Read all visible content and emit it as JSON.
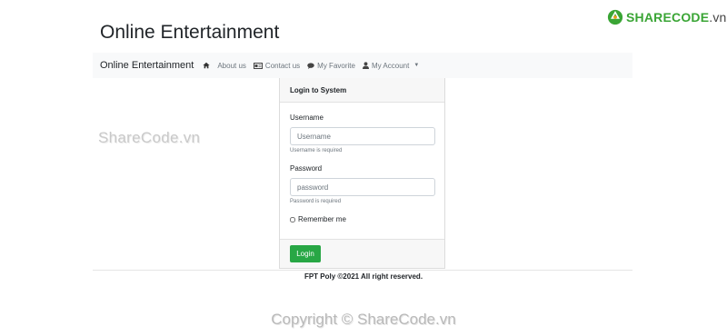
{
  "watermark_logo": {
    "green": "SHARECODE",
    "rest": ".vn"
  },
  "site_title": "Online Entertainment",
  "nav": {
    "brand": "Online Entertainment",
    "home_icon": "home-icon",
    "items": [
      {
        "label": "About us",
        "icon": ""
      },
      {
        "label": "Contact us",
        "icon": "card-icon"
      },
      {
        "label": "My Favorite",
        "icon": "comment-icon"
      },
      {
        "label": "My Account",
        "icon": "user-icon"
      }
    ]
  },
  "login": {
    "title": "Login to System",
    "username_label": "Username",
    "username_placeholder": "Username",
    "username_hint": "Username is required",
    "password_label": "Password",
    "password_placeholder": "password",
    "password_hint": "Password is required",
    "remember_label": "Remember me",
    "submit_label": "Login"
  },
  "footer": "FPT Poly ©2021 All right reserved.",
  "watermarks": {
    "side": "ShareCode.vn",
    "bottom": "Copyright © ShareCode.vn"
  },
  "colors": {
    "accent": "#28a745",
    "logo_green": "#3aa535",
    "navbar_bg": "#f8f9fa"
  }
}
